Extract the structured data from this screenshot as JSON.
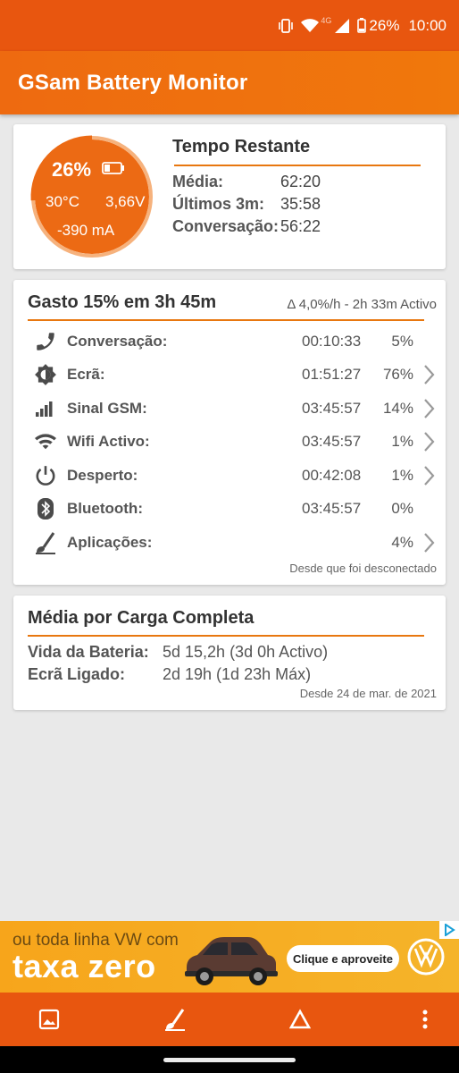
{
  "status": {
    "battery_pct": "26%",
    "time": "10:00",
    "network": "4G",
    "icons": [
      "vibrate-icon",
      "wifi-icon",
      "signal-icon",
      "battery-icon"
    ]
  },
  "app": {
    "title": "GSam Battery Monitor"
  },
  "gauge": {
    "percent": "26%",
    "level": 0.26,
    "temperature": "30°C",
    "voltage": "3,66V",
    "current": "-390 mA",
    "color": "#ec6a14"
  },
  "remaining": {
    "title": "Tempo Restante",
    "rows": [
      {
        "label": "Média:",
        "value": "62:20"
      },
      {
        "label": "Últimos 3m:",
        "value": "35:58"
      },
      {
        "label": "Conversação:",
        "value": "56:22"
      }
    ]
  },
  "usage": {
    "title": "Gasto 15% em 3h 45m",
    "rate": "Δ 4,0%/h - 2h 33m Activo",
    "rows": [
      {
        "icon": "phone-icon",
        "name": "Conversação:",
        "time": "00:10:33",
        "pct": "5%",
        "chevron": false
      },
      {
        "icon": "brightness-icon",
        "name": "Ecrã:",
        "time": "01:51:27",
        "pct": "76%",
        "chevron": true
      },
      {
        "icon": "signal-bars-icon",
        "name": "Sinal GSM:",
        "time": "03:45:57",
        "pct": "14%",
        "chevron": true
      },
      {
        "icon": "wifi-icon",
        "name": "Wifi Activo:",
        "time": "03:45:57",
        "pct": "1%",
        "chevron": true
      },
      {
        "icon": "power-icon",
        "name": "Desperto:",
        "time": "00:42:08",
        "pct": "1%",
        "chevron": true
      },
      {
        "icon": "bluetooth-icon",
        "name": "Bluetooth:",
        "time": "03:45:57",
        "pct": "0%",
        "chevron": false
      },
      {
        "icon": "apps-icon",
        "name": "Aplicações:",
        "time": "",
        "pct": "4%",
        "chevron": true
      }
    ],
    "note": "Desde que foi desconectado"
  },
  "full_charge": {
    "title": "Média por Carga Completa",
    "rows": [
      {
        "label": "Vida da Bateria:",
        "value": "5d 15,2h (3d 0h Activo)"
      },
      {
        "label": "Ecrã Ligado:",
        "value": "2d 19h (1d 23h Máx)"
      }
    ],
    "note": "Desde 24 de mar. de 2021"
  },
  "ad": {
    "line1": "ou toda linha VW com",
    "line2": "taxa zero",
    "cta": "Clique e aproveite"
  },
  "bottom_bar": [
    "image-icon",
    "apps-icon",
    "delta-icon",
    "more-vert-icon"
  ]
}
